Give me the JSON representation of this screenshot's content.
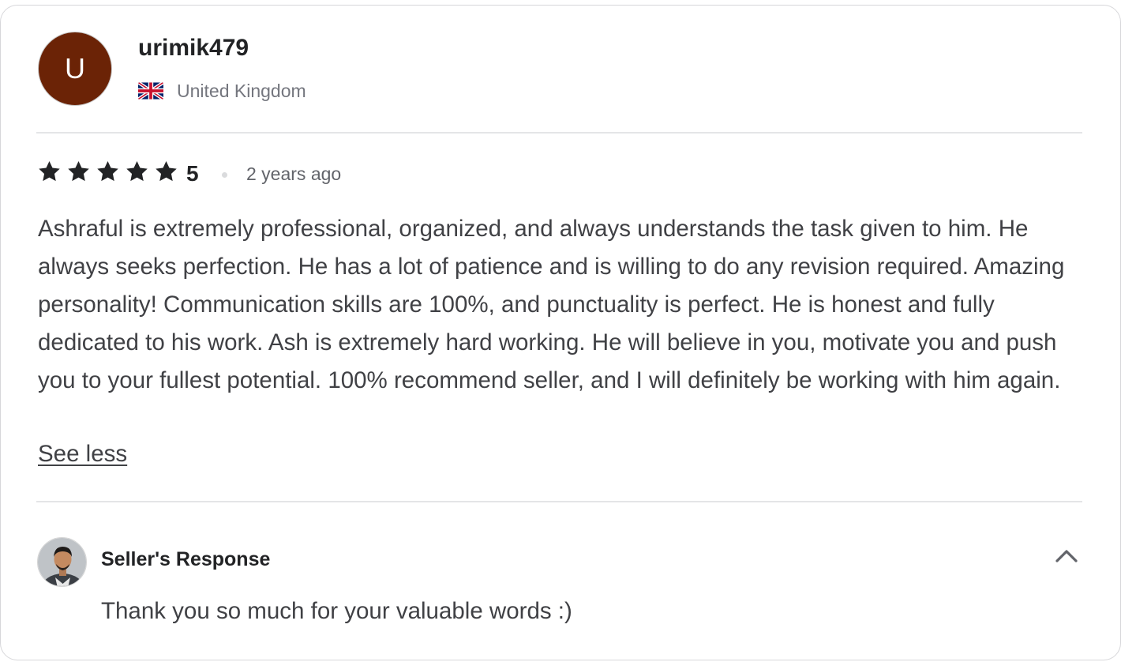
{
  "reviewer": {
    "avatar_initial": "U",
    "avatar_color": "#6b2306",
    "username": "urimik479",
    "flag_icon": "uk-flag-icon",
    "country": "United Kingdom"
  },
  "review": {
    "stars": 5,
    "rating": "5",
    "time_ago": "2 years ago",
    "text": "Ashraful is extremely professional, organized, and always understands the task given to him. He always seeks perfection. He has a lot of patience and is willing to do any revision required. Amazing personality! Communication skills are 100%, and punctuality is perfect. He is honest and fully dedicated to his work. Ash is extremely hard working. He will believe in you, motivate you and push you to your fullest potential. 100% recommend seller, and I will definitely be working with him again.",
    "toggle_label": "See less"
  },
  "seller_response": {
    "title": "Seller's Response",
    "text": "Thank you so much for your valuable words :)",
    "collapse_icon": "chevron-up-icon"
  },
  "colors": {
    "star": "#222325",
    "text_primary": "#222325",
    "text_body": "#404145",
    "text_muted": "#74767e"
  }
}
